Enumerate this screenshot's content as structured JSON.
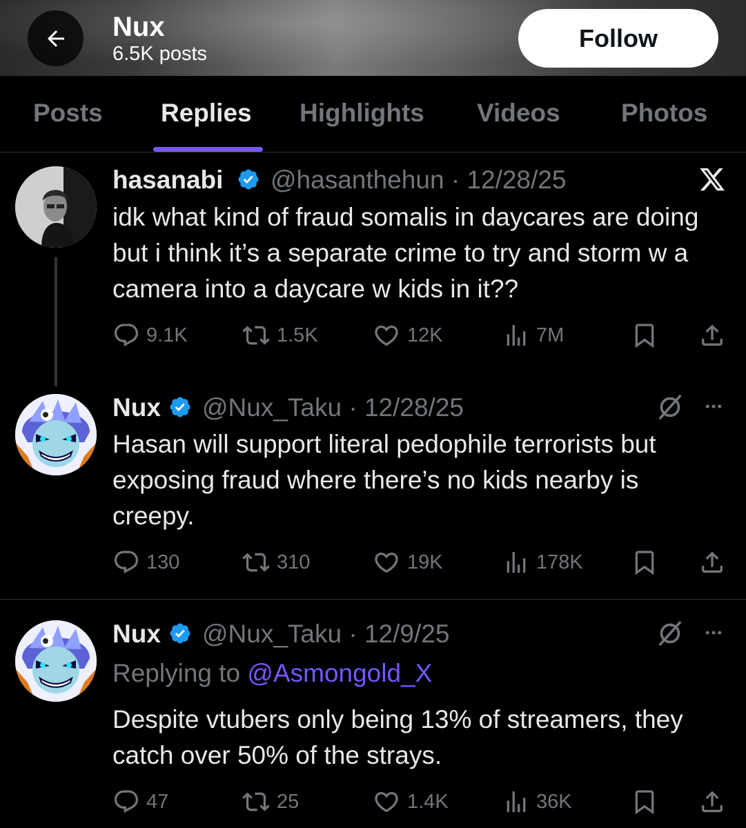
{
  "header": {
    "name": "Nux",
    "post_count": "6.5K posts",
    "follow_label": "Follow"
  },
  "tabs": [
    {
      "label": "Posts"
    },
    {
      "label": "Replies",
      "active": true
    },
    {
      "label": "Highlights"
    },
    {
      "label": "Videos"
    },
    {
      "label": "Photos"
    }
  ],
  "colors": {
    "accent": "#7856ff",
    "verified": "#1d9bf0",
    "muted": "#71767b",
    "text": "#e7e9ea"
  },
  "tweets": [
    {
      "name": "hasanabi",
      "handle": "@hasanthehun · 12/28/25",
      "text": "idk what kind of fraud somalis in daycares are doing but i think it’s a separate crime to try and storm w a camera into a daycare w kids in it??",
      "replies": "9.1K",
      "reposts": "1.5K",
      "likes": "12K",
      "views": "7M",
      "corner_icon": "x-logo-icon"
    },
    {
      "name": "Nux",
      "handle": "@Nux_Taku · 12/28/25",
      "text": "Hasan will support literal pedophile terrorists but exposing fraud where there’s no kids nearby is creepy.",
      "replies": "130",
      "reposts": "310",
      "likes": "19K",
      "views": "178K",
      "corner_icon": "grok-icon"
    },
    {
      "name": "Nux",
      "handle": "@Nux_Taku · 12/9/25",
      "replying_prefix": "Replying to ",
      "replying_to": "@Asmongold_X",
      "text": "Despite vtubers only being 13% of streamers, they catch over 50% of the strays.",
      "replies": "47",
      "reposts": "25",
      "likes": "1.4K",
      "views": "36K",
      "corner_icon": "grok-icon"
    }
  ]
}
